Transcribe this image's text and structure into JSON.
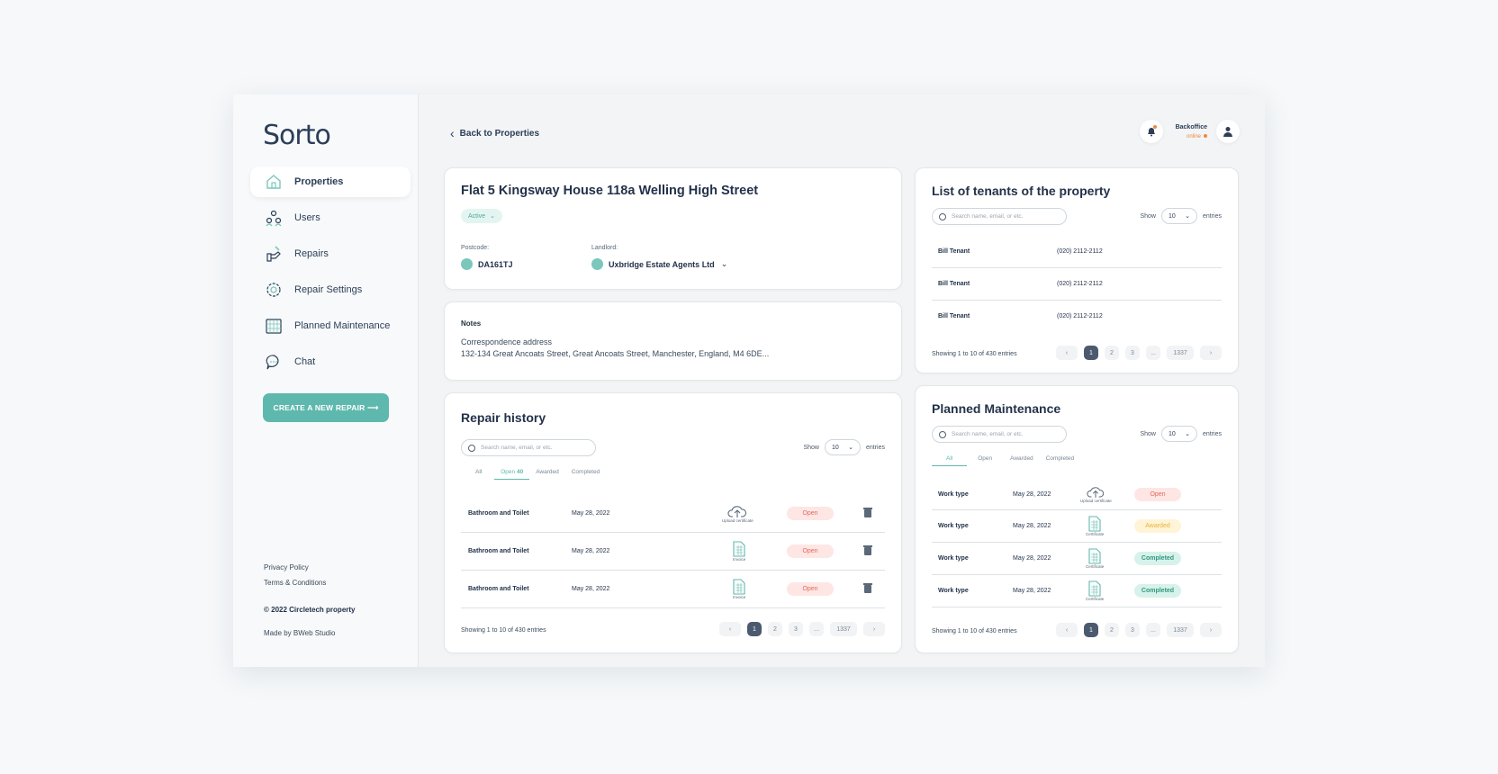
{
  "brand": {
    "name": "Sorto"
  },
  "sidebar": {
    "items": [
      {
        "label": "Properties",
        "icon": "home-icon"
      },
      {
        "label": "Users",
        "icon": "users-icon"
      },
      {
        "label": "Repairs",
        "icon": "repair-hand-icon"
      },
      {
        "label": "Repair Settings",
        "icon": "gear-icon"
      },
      {
        "label": "Planned Maintenance",
        "icon": "calendar-icon"
      },
      {
        "label": "Chat",
        "icon": "chat-icon"
      }
    ],
    "cta": "CREATE A NEW REPAIR ⟶",
    "footer": {
      "privacy": "Privacy Policy",
      "terms": "Terms & Conditions",
      "copyright": "© 2022 Circletech property",
      "made_by": "Made by BWeb Studio"
    }
  },
  "header": {
    "back": "Back to Properties",
    "user_name": "Backoffice",
    "user_status": "online"
  },
  "property": {
    "title": "Flat 5 Kingsway House 118a Welling High Street",
    "status": "Active",
    "postcode_label": "Postcode:",
    "postcode": "DA161TJ",
    "landlord_label": "Landlord:",
    "landlord": "Uxbridge Estate Agents Ltd"
  },
  "notes": {
    "title": "Notes",
    "line1": "Correspondence address",
    "line2": "132-134 Great Ancoats Street, Great Ancoats Street, Manchester, England, M4 6DE..."
  },
  "repair_history": {
    "title": "Repair history",
    "search_placeholder": "Search name, email, or etc.",
    "show_label": "Show",
    "show_value": "10",
    "entries_label": "entries",
    "tabs": {
      "all": "All",
      "open": "Open",
      "open_count": "40",
      "awarded": "Awarded",
      "completed": "Completed"
    },
    "rows": [
      {
        "type": "Bathroom and Toilet",
        "date": "May 28, 2022",
        "doc": "Upload certificate",
        "doc_icon": "upload-cloud-icon",
        "status": "Open"
      },
      {
        "type": "Bathroom and Toilet",
        "date": "May 28, 2022",
        "doc": "Invoice",
        "doc_icon": "document-icon",
        "status": "Open"
      },
      {
        "type": "Bathroom and Toilet",
        "date": "May 28, 2022",
        "doc": "Invoice",
        "doc_icon": "document-icon",
        "status": "Open"
      }
    ],
    "showing": "Showing 1 to 10 of 430 entries",
    "pages": [
      "1",
      "2",
      "3",
      "...",
      "1337"
    ]
  },
  "tenants": {
    "title": "List of tenants of the property",
    "search_placeholder": "Search name, email, or etc.",
    "show_label": "Show",
    "show_value": "10",
    "entries_label": "entries",
    "rows": [
      {
        "name": "Bill Tenant",
        "phone": "(020) 2112-2112"
      },
      {
        "name": "Bill Tenant",
        "phone": "(020) 2112-2112"
      },
      {
        "name": "Bill Tenant",
        "phone": "(020) 2112-2112"
      }
    ],
    "showing": "Showing 1 to 10 of 430 entries",
    "pages": [
      "1",
      "2",
      "3",
      "...",
      "1337"
    ]
  },
  "maintenance": {
    "title": "Planned Maintenance",
    "search_placeholder": "Search name, email, or etc.",
    "show_label": "Show",
    "show_value": "10",
    "entries_label": "entries",
    "tabs": {
      "all": "All",
      "open": "Open",
      "awarded": "Awarded",
      "completed": "Completed"
    },
    "rows": [
      {
        "type": "Work type",
        "date": "May 28, 2022",
        "doc": "Upload certificate",
        "doc_icon": "upload-cloud-icon",
        "status": "Open"
      },
      {
        "type": "Work type",
        "date": "May 28, 2022",
        "doc": "Certificate",
        "doc_icon": "document-icon",
        "status": "Awarded"
      },
      {
        "type": "Work type",
        "date": "May 28, 2022",
        "doc": "Certificate",
        "doc_icon": "document-icon",
        "status": "Completed"
      },
      {
        "type": "Work type",
        "date": "May 28, 2022",
        "doc": "Certificate",
        "doc_icon": "document-icon",
        "status": "Completed"
      }
    ],
    "showing": "Showing 1 to 10 of 430 entries",
    "pages": [
      "1",
      "2",
      "3",
      "...",
      "1337"
    ]
  },
  "colors": {
    "accent": "#5fb8ad",
    "open": "#e26b5e",
    "awarded": "#e6b43a",
    "completed": "#33987f",
    "online": "#f08a3a"
  }
}
